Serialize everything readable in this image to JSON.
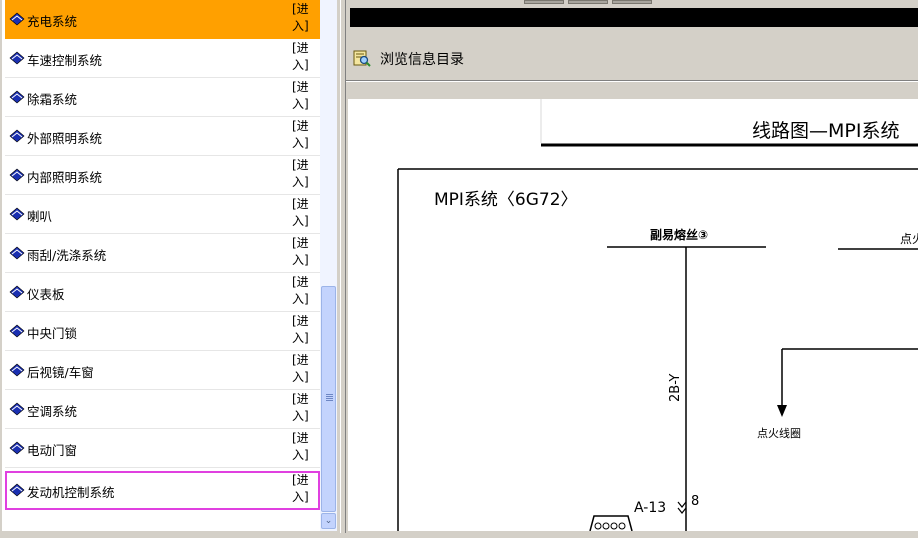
{
  "system_list": {
    "enter_label": "[进\n入]",
    "items": [
      {
        "name": "充电系统",
        "selected": true
      },
      {
        "name": "车速控制系统"
      },
      {
        "name": "除霜系统"
      },
      {
        "name": "外部照明系统"
      },
      {
        "name": "内部照明系统"
      },
      {
        "name": "喇叭"
      },
      {
        "name": "雨刮/洗涤系统"
      },
      {
        "name": "仪表板"
      },
      {
        "name": "中央门锁"
      },
      {
        "name": "后视镜/车窗"
      },
      {
        "name": "空调系统"
      },
      {
        "name": "电动门窗"
      },
      {
        "name": "发动机控制系统",
        "focused": true
      }
    ]
  },
  "toolbar": {
    "browse_label": "浏览信息目录",
    "browse_icon": "browse-catalog-icon"
  },
  "diagram": {
    "page_title": "线路图—MPI系统",
    "section_title": "MPI系统〈6G72〉",
    "fuse_label": "副易熔丝③",
    "top_right_label": "点火",
    "wire_code": "2B-Y",
    "ignition_coil_label": "点火线圈",
    "connector_label": "A-13",
    "pin_label": "8"
  },
  "colors": {
    "selected_row": "#ffa000",
    "focus_outline": "#e040e0",
    "scrollbar_thumb": "#c3d3fd"
  }
}
